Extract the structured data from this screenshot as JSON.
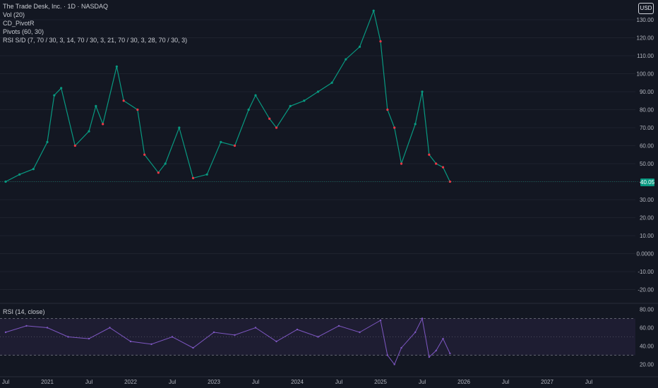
{
  "legend": {
    "title": "The Trade Desk, Inc. · 1D · NASDAQ",
    "vol": "Vol (20)",
    "pivotr": "CD_PivotR",
    "pivots": "Pivots (60, 30)",
    "rsisd": "RSI S/D (7, 70 / 30, 3, 14, 70 / 30, 3, 21, 70 / 30, 3, 28, 70 / 30, 3)"
  },
  "rsi_legend": "RSI (14, close)",
  "currency_button": "USD",
  "last_price": "40.05",
  "colors": {
    "up": "#089981",
    "down": "#f23645",
    "rsi": "#7e57c2",
    "rsi_ma": "#f0c14b",
    "zone": "#2962ff",
    "support": "#f23645",
    "resistance": "#4caf50"
  },
  "chart_data": [
    {
      "type": "line",
      "title": "",
      "x_tick_labels": [
        "Jul",
        "2021",
        "Jul",
        "2022",
        "Jul",
        "2023",
        "Jul",
        "2024",
        "Jul",
        "2025",
        "Jul",
        "2026",
        "Jul",
        "2027",
        "Jul"
      ],
      "y_tick_labels": [
        "130.00",
        "120.00",
        "110.00",
        "100.00",
        "90.00",
        "80.00",
        "70.00",
        "60.00",
        "50.00",
        "40.00",
        "30.00",
        "20.00",
        "10.00",
        "0.0000",
        "-10.00",
        "-20.00"
      ],
      "ylim": [
        -25,
        140
      ],
      "x": [
        "2020-07",
        "2020-09",
        "2020-11",
        "2021-01",
        "2021-02",
        "2021-03",
        "2021-05",
        "2021-07",
        "2021-08",
        "2021-09",
        "2021-11",
        "2021-12",
        "2022-02",
        "2022-03",
        "2022-05",
        "2022-06",
        "2022-08",
        "2022-10",
        "2022-12",
        "2023-02",
        "2023-04",
        "2023-06",
        "2023-07",
        "2023-09",
        "2023-10",
        "2023-12",
        "2024-02",
        "2024-04",
        "2024-06",
        "2024-08",
        "2024-10",
        "2024-12",
        "2025-01",
        "2025-02",
        "2025-03",
        "2025-04",
        "2025-06",
        "2025-07",
        "2025-08",
        "2025-09",
        "2025-10",
        "2025-11"
      ],
      "series": [
        {
          "values": [
            40,
            44,
            47,
            62,
            88,
            92,
            60,
            68,
            82,
            72,
            104,
            85,
            80,
            55,
            45,
            50,
            70,
            42,
            44,
            62,
            60,
            80,
            88,
            75,
            70,
            82,
            85,
            90,
            95,
            108,
            115,
            135,
            118,
            80,
            70,
            50,
            72,
            90,
            55,
            50,
            48,
            40
          ]
        }
      ]
    },
    {
      "type": "line",
      "title": "",
      "rsi_y_tick_labels": [
        "80.00",
        "60.00",
        "40.00",
        "20.00"
      ],
      "ylim": [
        15,
        85
      ],
      "bands": [
        30,
        70
      ],
      "x": [
        "2020-07",
        "2020-10",
        "2021-01",
        "2021-04",
        "2021-07",
        "2021-10",
        "2022-01",
        "2022-04",
        "2022-07",
        "2022-10",
        "2023-01",
        "2023-04",
        "2023-07",
        "2023-10",
        "2024-01",
        "2024-04",
        "2024-07",
        "2024-10",
        "2025-01",
        "2025-02",
        "2025-03",
        "2025-04",
        "2025-06",
        "2025-07",
        "2025-08",
        "2025-09",
        "2025-10",
        "2025-11"
      ],
      "series": [
        {
          "values": [
            55,
            62,
            60,
            50,
            48,
            60,
            45,
            42,
            50,
            38,
            55,
            52,
            60,
            45,
            58,
            50,
            62,
            55,
            68,
            30,
            20,
            38,
            55,
            70,
            28,
            35,
            48,
            32
          ]
        }
      ]
    }
  ]
}
